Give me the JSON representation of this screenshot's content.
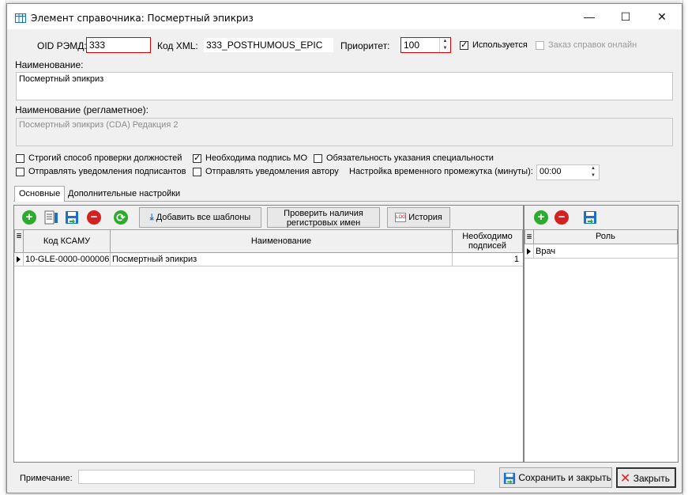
{
  "window": {
    "title": "Элемент справочника: Посмертный эпикриз",
    "minimize": "—",
    "maximize": "☐",
    "close": "✕"
  },
  "header": {
    "oid_label": "OID РЭМД:",
    "oid_value": "333",
    "xml_label": "Код XML:",
    "xml_value": "333_POSTHUMOUS_EPIC",
    "priority_label": "Приоритет:",
    "priority_value": "100",
    "used_label": "Используется",
    "used_checked": true,
    "online_label": "Заказ справок онлайн",
    "online_checked": false
  },
  "name": {
    "label": "Наименование:",
    "value": "Посмертный эпикриз"
  },
  "reg_name": {
    "label": "Наименование (регламетное):",
    "value": "Посмертный эпикриз (CDA) Редакция 2"
  },
  "options": {
    "strict_label": "Строгий способ проверки должностей",
    "strict_checked": false,
    "sign_label": "Необходима подпись МО",
    "sign_checked": true,
    "spec_label": "Обязательность указания специальности",
    "spec_checked": false,
    "notify_signers_label": "Отправлять уведомления подписантов",
    "notify_signers_checked": false,
    "notify_author_label": "Отправлять уведомления автору",
    "notify_author_checked": false,
    "interval_label": "Настройка временного промежутка (минуты):",
    "interval_value": "00:00"
  },
  "tabs": [
    {
      "label": "Основные",
      "active": true
    },
    {
      "label": "Дополнительные настройки",
      "active": false
    }
  ],
  "toolbar": {
    "add_all_label": "Добавить все шаблоны",
    "check_reg_label_1": "Проверить наличия",
    "check_reg_label_2": "регистровых имен",
    "history_label": "История"
  },
  "main_table": {
    "columns": [
      "Код КСАМУ",
      "Наименование",
      "Необходимо",
      "подписей"
    ],
    "rows": [
      {
        "code": "10-GLE-0000-000006",
        "name": "Посмертный эпикриз",
        "signs": "1"
      }
    ]
  },
  "roles_table": {
    "column": "Роль",
    "rows": [
      {
        "role": "Врач"
      }
    ]
  },
  "footer": {
    "note_label": "Примечание:",
    "note_value": "",
    "save_label": "Сохранить и закрыть",
    "close_label": "Закрыть"
  },
  "colors": {
    "accent_red": "#e00000",
    "add_green": "#2eaa2e",
    "remove_red": "#d62020",
    "save_blue": "#1e6fc9"
  }
}
